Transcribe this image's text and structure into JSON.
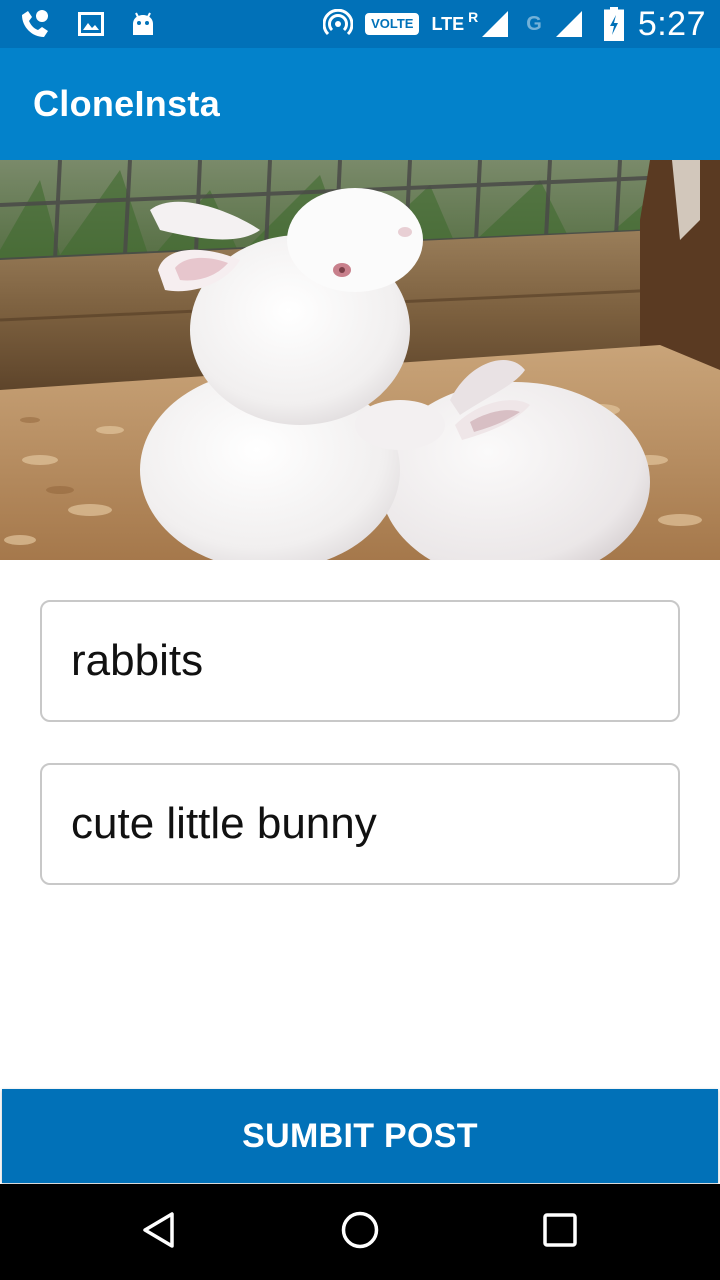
{
  "status_bar": {
    "time": "5:27",
    "volte_label": "VOLTE",
    "lte_label": "LTE",
    "roaming_label": "R",
    "network_label": "G",
    "icons": [
      "missed-call-icon",
      "image-icon",
      "android-icon",
      "hotspot-icon",
      "signal-icon",
      "signal-icon",
      "battery-charging-icon"
    ]
  },
  "app_bar": {
    "title": "CloneInsta"
  },
  "post": {
    "image_description_icon": "photo-icon"
  },
  "form": {
    "title_value": "rabbits",
    "caption_value": "cute little bunny"
  },
  "actions": {
    "submit_label": "SUMBIT POST"
  },
  "nav_bar": {
    "icons": [
      "back-icon",
      "home-icon",
      "recents-icon"
    ]
  },
  "colors": {
    "status_bar": "#0171b8",
    "app_bar": "#0382cb",
    "submit_button": "#0171b8",
    "nav_bar": "#000000"
  }
}
